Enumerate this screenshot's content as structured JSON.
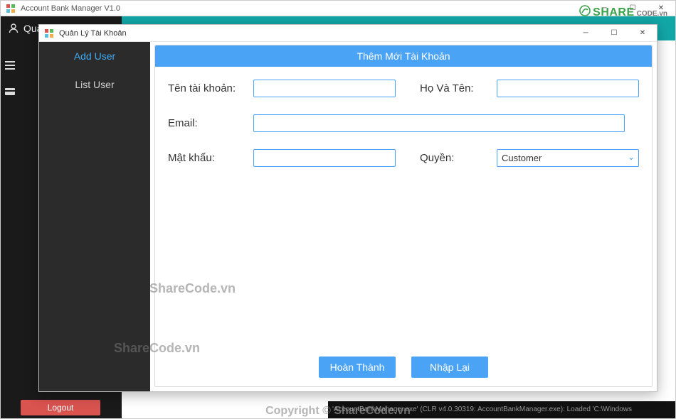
{
  "shell": {
    "title": "Account Bank Manager V1.0",
    "user_label": "Qua"
  },
  "logout_label": "Logout",
  "child": {
    "title": "Quản Lý Tài Khoản",
    "sidebar": {
      "items": [
        {
          "label": "Add User",
          "active": true
        },
        {
          "label": "List User",
          "active": false
        }
      ]
    },
    "panel": {
      "header": "Thêm Mới Tài Khoản",
      "labels": {
        "account_name": "Tên tài khoản:",
        "full_name": "Họ Và Tên:",
        "email": "Email:",
        "password": "Mật khẩu:",
        "role": "Quyền:"
      },
      "values": {
        "account_name": "",
        "full_name": "",
        "email": "",
        "password": "",
        "role": "Customer"
      },
      "buttons": {
        "complete": "Hoàn Thành",
        "reset": "Nhập Lại"
      }
    }
  },
  "watermarks": {
    "wm1": "ShareCode.vn",
    "wm2": "ShareCode.vn",
    "logo_main": "SHARE",
    "logo_sub": "CODE.vn",
    "copyright": "Copyright © ShareCode.vn"
  },
  "console_text": "'AccountBankManager.exe' (CLR v4.0.30319: AccountBankManager.exe): Loaded 'C:\\Windows"
}
